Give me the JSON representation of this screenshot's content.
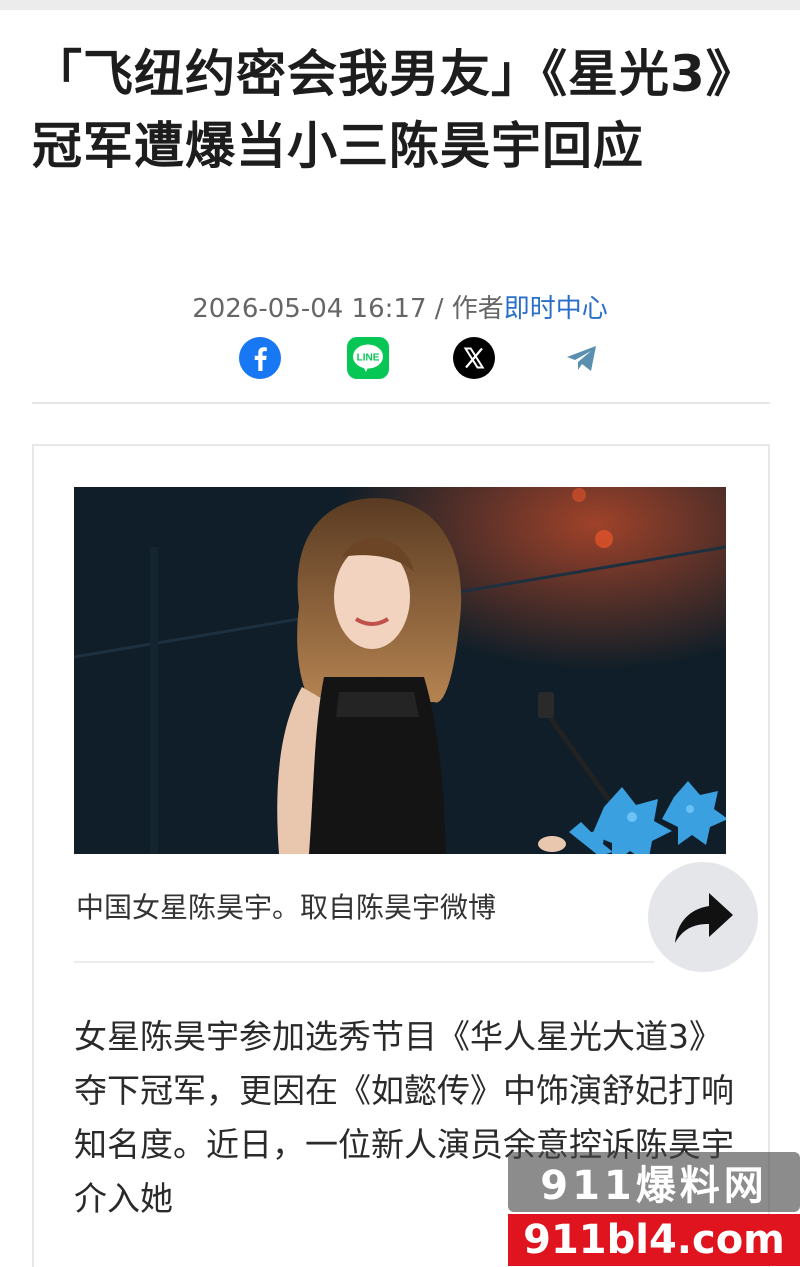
{
  "article": {
    "title": "「飞纽约密会我男友」《星光3》冠军遭爆当小三陈昊宇回应",
    "date": "2026-05-04 16:17",
    "author_label": "作者",
    "author": "即时中心",
    "separator": " / "
  },
  "share": {
    "icons": [
      "facebook-icon",
      "line-icon",
      "x-icon",
      "telegram-icon"
    ],
    "line_label": "LINE",
    "x_label": "𝕏"
  },
  "figure": {
    "caption": "中国女星陈昊宇。取自陈昊宇微博"
  },
  "body": {
    "paragraph": "女星陈昊宇参加选秀节目《华人星光大道3》夺下冠军，更因在《如懿传》中饰演舒妃打响知名度。近日，一位新人演员余意控诉陈昊宇介入她"
  },
  "watermark": {
    "top": "911爆料网",
    "bottom": "911bl4.com"
  },
  "colors": {
    "facebook": "#1877f2",
    "line": "#06c755",
    "x": "#000000",
    "telegram": "#5b8fb0",
    "author_link": "#2a6fc9",
    "watermark_red": "#e0141e"
  }
}
